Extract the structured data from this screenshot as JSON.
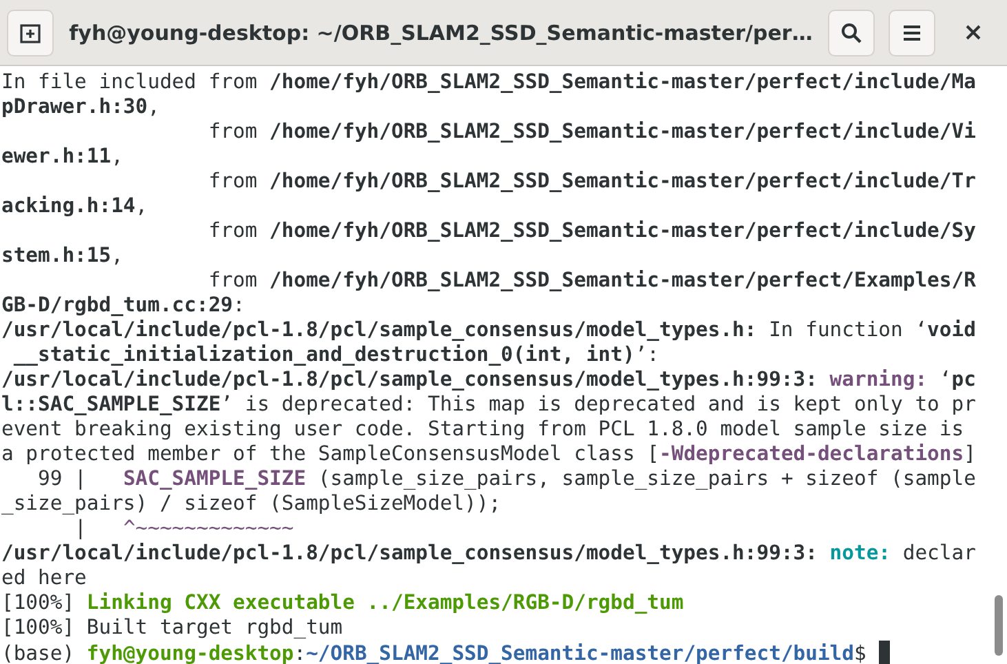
{
  "window": {
    "title": "fyh@young-desktop: ~/ORB_SLAM2_SSD_Semantic-master/per…"
  },
  "terminal": {
    "lines": [
      [
        {
          "t": "In file included from ",
          "kind": "plain"
        },
        {
          "t": "/home/fyh/ORB_SLAM2_SSD_Semantic-master/perfect/include/Ma",
          "kind": "bold"
        }
      ],
      [
        {
          "t": "pDrawer.h:30",
          "kind": "bold"
        },
        {
          "t": ",",
          "kind": "plain"
        }
      ],
      [
        {
          "t": "                 from ",
          "kind": "plain"
        },
        {
          "t": "/home/fyh/ORB_SLAM2_SSD_Semantic-master/perfect/include/Vi",
          "kind": "bold"
        }
      ],
      [
        {
          "t": "ewer.h:11",
          "kind": "bold"
        },
        {
          "t": ",",
          "kind": "plain"
        }
      ],
      [
        {
          "t": "                 from ",
          "kind": "plain"
        },
        {
          "t": "/home/fyh/ORB_SLAM2_SSD_Semantic-master/perfect/include/Tr",
          "kind": "bold"
        }
      ],
      [
        {
          "t": "acking.h:14",
          "kind": "bold"
        },
        {
          "t": ",",
          "kind": "plain"
        }
      ],
      [
        {
          "t": "                 from ",
          "kind": "plain"
        },
        {
          "t": "/home/fyh/ORB_SLAM2_SSD_Semantic-master/perfect/include/Sy",
          "kind": "bold"
        }
      ],
      [
        {
          "t": "stem.h:15",
          "kind": "bold"
        },
        {
          "t": ",",
          "kind": "plain"
        }
      ],
      [
        {
          "t": "                 from ",
          "kind": "plain"
        },
        {
          "t": "/home/fyh/ORB_SLAM2_SSD_Semantic-master/perfect/Examples/R",
          "kind": "bold"
        }
      ],
      [
        {
          "t": "GB-D/rgbd_tum.cc:29",
          "kind": "bold"
        },
        {
          "t": ":",
          "kind": "plain"
        }
      ],
      [
        {
          "t": "/usr/local/include/pcl-1.8/pcl/sample_consensus/model_types.h:",
          "kind": "bold"
        },
        {
          "t": " In function ‘",
          "kind": "plain"
        },
        {
          "t": "void",
          "kind": "bold"
        }
      ],
      [
        {
          "t": " __static_initialization_and_destruction_0(int, int)",
          "kind": "bold"
        },
        {
          "t": "’:",
          "kind": "plain"
        }
      ],
      [
        {
          "t": "/usr/local/include/pcl-1.8/pcl/sample_consensus/model_types.h:99:3:",
          "kind": "bold"
        },
        {
          "t": " warning:",
          "kind": "purple"
        },
        {
          "t": " ‘",
          "kind": "plain"
        },
        {
          "t": "pc",
          "kind": "bold"
        }
      ],
      [
        {
          "t": "l::SAC_SAMPLE_SIZE",
          "kind": "bold"
        },
        {
          "t": "’ is deprecated: This map is deprecated and is kept only to pr",
          "kind": "plain"
        }
      ],
      [
        {
          "t": "event breaking existing user code. Starting from PCL 1.8.0 model sample size is",
          "kind": "plain"
        }
      ],
      [
        {
          "t": "a protected member of the SampleConsensusModel class [",
          "kind": "plain"
        },
        {
          "t": "-Wdeprecated-declarations",
          "kind": "purple"
        },
        {
          "t": "]",
          "kind": "plain"
        }
      ],
      [
        {
          "t": "   99 |   ",
          "kind": "plain"
        },
        {
          "t": "SAC_SAMPLE_SIZE",
          "kind": "purple"
        },
        {
          "t": " (sample_size_pairs, sample_size_pairs + sizeof (sample",
          "kind": "plain"
        }
      ],
      [
        {
          "t": "_size_pairs) / sizeof (SampleSizeModel));",
          "kind": "plain"
        }
      ],
      [
        {
          "t": "      |   ",
          "kind": "plain"
        },
        {
          "t": "^~~~~~~~~~~~~~",
          "kind": "tilde"
        }
      ],
      [
        {
          "t": "/usr/local/include/pcl-1.8/pcl/sample_consensus/model_types.h:99:3:",
          "kind": "bold"
        },
        {
          "t": " note:",
          "kind": "teal"
        },
        {
          "t": " declar",
          "kind": "plain"
        }
      ],
      [
        {
          "t": "ed here",
          "kind": "plain"
        }
      ],
      [
        {
          "t": "[100%] ",
          "kind": "plain"
        },
        {
          "t": "Linking CXX executable ../Examples/RGB-D/rgbd_tum",
          "kind": "green"
        }
      ],
      [
        {
          "t": "[100%] Built target rgbd_tum",
          "kind": "plain"
        }
      ],
      [
        {
          "t": "(base) ",
          "kind": "plain"
        },
        {
          "t": "fyh@young-desktop",
          "kind": "green"
        },
        {
          "t": ":",
          "kind": "plain"
        },
        {
          "t": "~/ORB_SLAM2_SSD_Semantic-master/perfect/build",
          "kind": "blue"
        },
        {
          "t": "$ ",
          "kind": "plain"
        }
      ]
    ]
  }
}
